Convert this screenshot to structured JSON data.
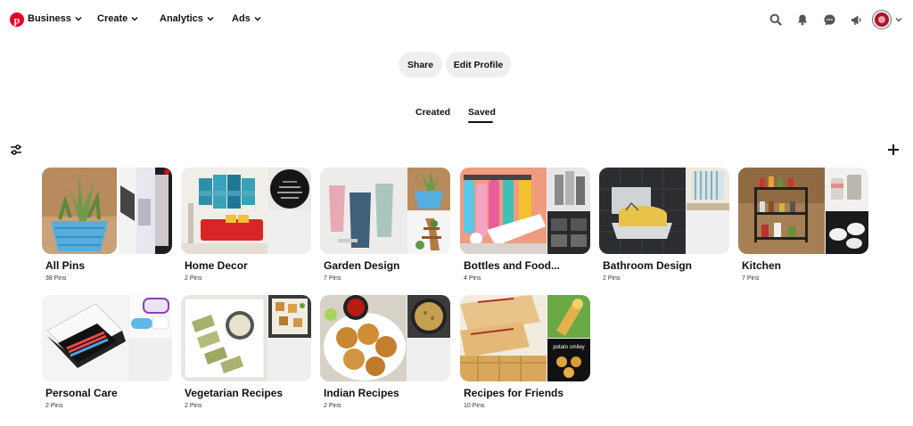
{
  "nav": {
    "business": "Business",
    "create": "Create",
    "analytics": "Analytics",
    "ads": "Ads"
  },
  "profile": {
    "share": "Share",
    "edit_profile": "Edit Profile"
  },
  "tabs": {
    "created": "Created",
    "saved": "Saved"
  },
  "boards": [
    {
      "title": "All Pins",
      "count": "38 Pins"
    },
    {
      "title": "Home Decor",
      "count": "2 Pins"
    },
    {
      "title": "Garden Design",
      "count": "7 Pins"
    },
    {
      "title": "Bottles and Food...",
      "count": "4 Pins"
    },
    {
      "title": "Bathroom Design",
      "count": "2 Pins"
    },
    {
      "title": "Kitchen",
      "count": "7 Pins"
    },
    {
      "title": "Personal Care",
      "count": "2 Pins"
    },
    {
      "title": "Vegetarian Recipes",
      "count": "2 Pins"
    },
    {
      "title": "Indian Recipes",
      "count": "2 Pins"
    },
    {
      "title": "Recipes for Friends",
      "count": "10 Pins"
    }
  ],
  "colors": {
    "brand": "#e60023",
    "pill_bg": "#efefef"
  },
  "icons": {
    "search": "search-icon",
    "notifications": "bell-icon",
    "messages": "chat-icon",
    "updates": "megaphone-icon",
    "filter": "filter-icon",
    "add": "plus-icon"
  }
}
